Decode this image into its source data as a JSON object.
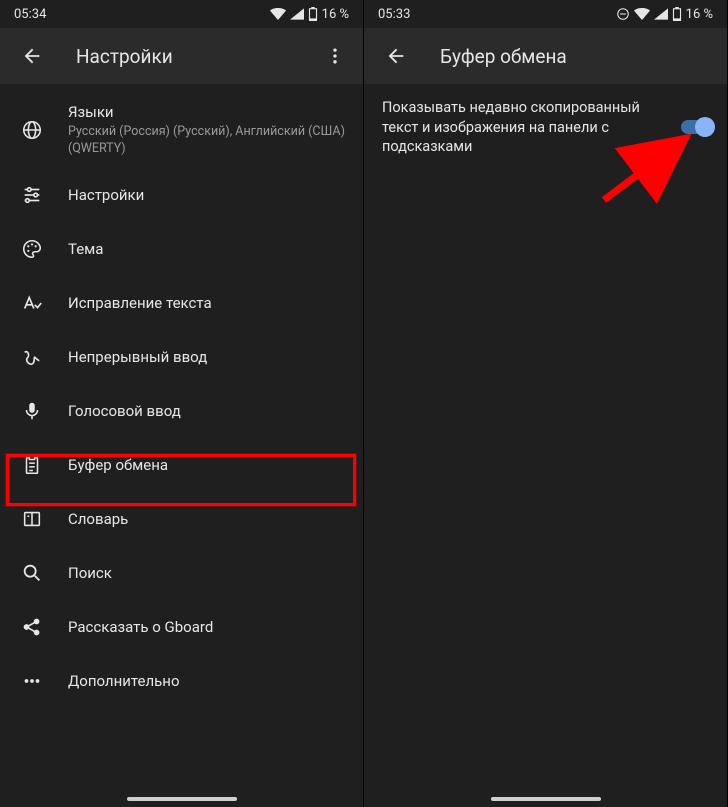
{
  "left": {
    "status": {
      "time": "05:34",
      "battery": "16 %"
    },
    "header": {
      "title": "Настройки"
    },
    "items": [
      {
        "title": "Языки",
        "sub": "Русский (Россия) (Русский), Английский (США) (QWERTY)"
      },
      {
        "title": "Настройки"
      },
      {
        "title": "Тема"
      },
      {
        "title": "Исправление текста"
      },
      {
        "title": "Непрерывный ввод"
      },
      {
        "title": "Голосовой ввод"
      },
      {
        "title": "Буфер обмена"
      },
      {
        "title": "Словарь"
      },
      {
        "title": "Поиск"
      },
      {
        "title": "Рассказать о Gboard"
      },
      {
        "title": "Дополнительно"
      }
    ]
  },
  "right": {
    "status": {
      "time": "05:33",
      "battery": "16 %"
    },
    "header": {
      "title": "Буфер обмена"
    },
    "option": {
      "label": "Показывать недавно скопированный текст и изображения на панели с подсказками"
    }
  }
}
